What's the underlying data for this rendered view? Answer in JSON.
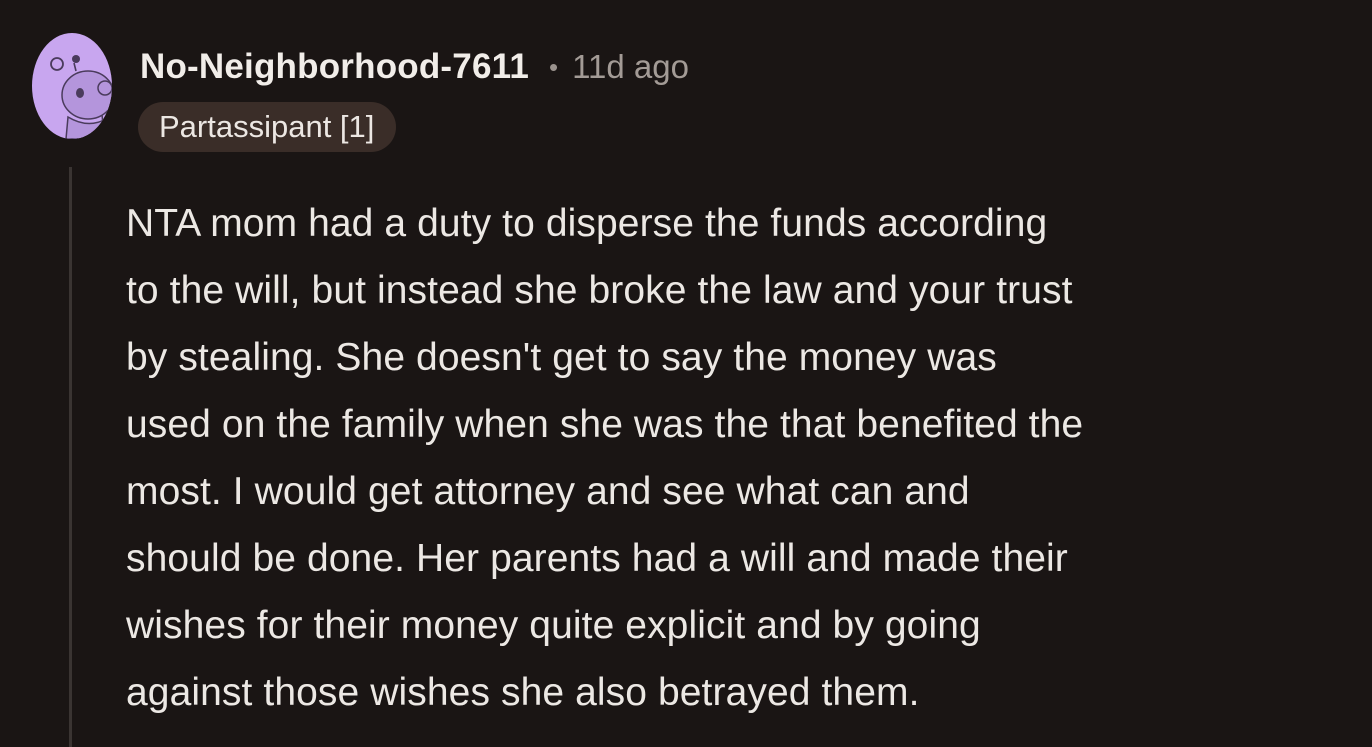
{
  "comment": {
    "username": "No-Neighborhood-7611",
    "separator": "•",
    "timestamp": "11d ago",
    "flair": "Partassipant [1]",
    "body": "NTA mom had a duty to disperse the funds according\nto the will, but instead she broke the law and your trust\nby stealing.  She doesn't get to say the money was\nused on the family when she was the that benefited the\nmost. I would get attorney and see what can and\nshould be done. Her parents had a will and made their\nwishes for their money quite explicit and by going\nagainst those wishes she also betrayed them.",
    "avatar": {
      "icon": "snoo-avatar-icon",
      "background_color": "#c8a6ef"
    }
  },
  "colors": {
    "page_background": "#1a1514",
    "flair_background": "#3a2d28",
    "thread_line": "#3a3432"
  }
}
